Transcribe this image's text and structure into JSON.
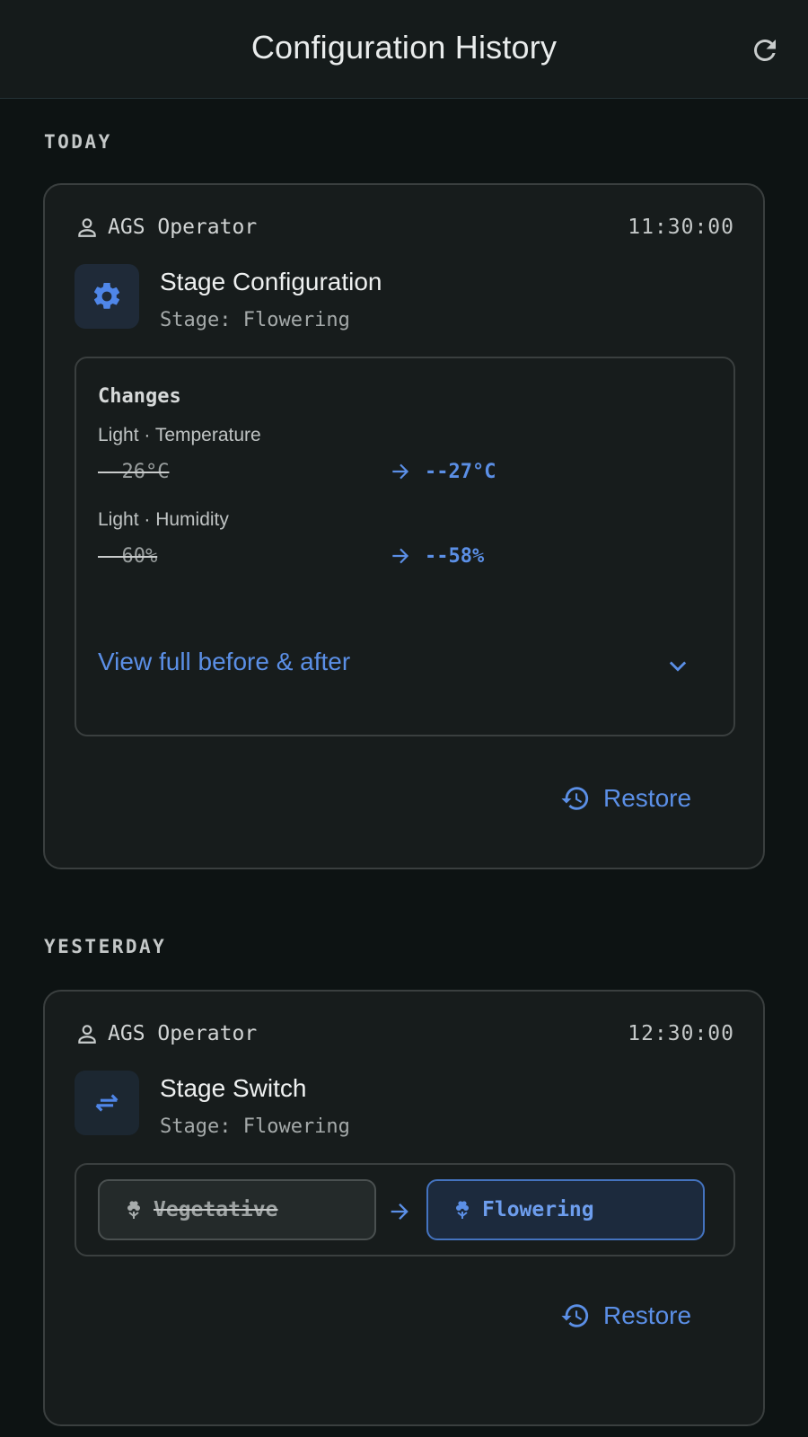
{
  "header": {
    "title": "Configuration History",
    "refresh_icon": "refresh-icon"
  },
  "sections": [
    {
      "label": "TODAY",
      "entry": {
        "user": "AGS Operator",
        "time": "11:30:00",
        "type_title": "Stage Configuration",
        "type_subtitle": "Stage: Flowering",
        "type_icon": "gear-icon",
        "changes": {
          "heading": "Changes",
          "items": [
            {
              "label": "Light · Temperature",
              "old": "--26°C",
              "new": "--27°C"
            },
            {
              "label": "Light · Humidity",
              "old": "--60%",
              "new": "--58%"
            }
          ],
          "view_full": "View full before & after"
        },
        "restore_label": "Restore"
      }
    },
    {
      "label": "YESTERDAY",
      "entry": {
        "user": "AGS Operator",
        "time": "12:30:00",
        "type_title": "Stage Switch",
        "type_subtitle": "Stage: Flowering",
        "type_icon": "swap-arrows-icon",
        "switch": {
          "from": "Vegetative",
          "to": "Flowering"
        },
        "restore_label": "Restore"
      }
    }
  ],
  "colors": {
    "accent": "#5b8fe6",
    "background": "#0d1313",
    "card": "#171c1c"
  }
}
